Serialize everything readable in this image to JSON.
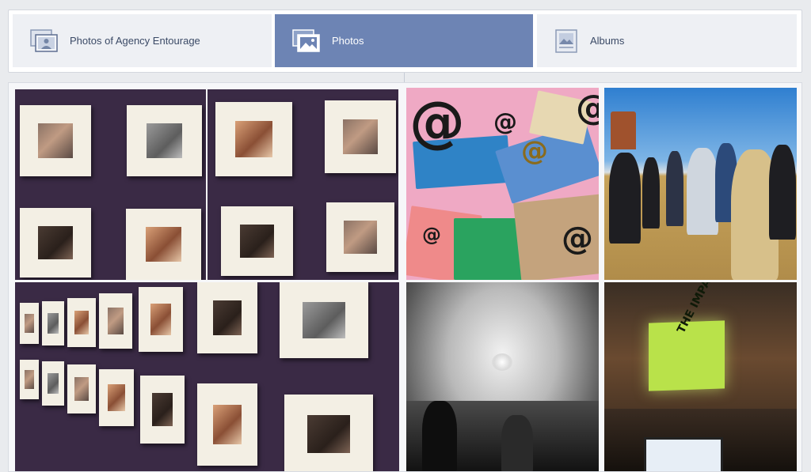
{
  "tabs": [
    {
      "label": "Photos of Agency Entourage",
      "icon": "tagged-photos-icon",
      "active": false
    },
    {
      "label": "Photos",
      "icon": "photos-icon",
      "active": true
    },
    {
      "label": "Albums",
      "icon": "albums-icon",
      "active": false
    }
  ],
  "colors": {
    "active_tab": "#6d84b4",
    "inactive_tab": "#eef0f4",
    "page_bg": "#e9ebee"
  },
  "photos": [
    {
      "subject": "frames-wall-left",
      "kind": "photo"
    },
    {
      "subject": "frames-wall-right",
      "kind": "photo"
    },
    {
      "subject": "email-envelopes",
      "kind": "photo"
    },
    {
      "subject": "press-conference-field",
      "kind": "photo"
    },
    {
      "subject": "frames-wall-angled",
      "kind": "photo"
    },
    {
      "subject": "tent-event-bw",
      "kind": "photo"
    },
    {
      "subject": "conference-room",
      "kind": "photo"
    }
  ],
  "screen_text": "THE IMPACT EQUATION"
}
